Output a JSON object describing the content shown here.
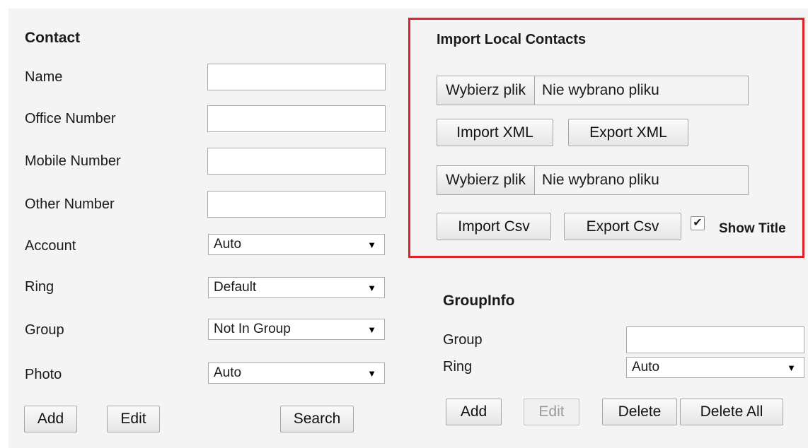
{
  "contact": {
    "title": "Contact",
    "name_label": "Name",
    "office_label": "Office Number",
    "mobile_label": "Mobile Number",
    "other_label": "Other Number",
    "account_label": "Account",
    "account_value": "Auto",
    "ring_label": "Ring",
    "ring_value": "Default",
    "group_label": "Group",
    "group_value": "Not In Group",
    "photo_label": "Photo",
    "photo_value": "Auto",
    "add_label": "Add",
    "edit_label": "Edit",
    "search_label": "Search"
  },
  "import": {
    "title": "Import Local Contacts",
    "choose_file_label": "Wybierz plik",
    "no_file_text": "Nie wybrano pliku",
    "import_xml_label": "Import XML",
    "export_xml_label": "Export XML",
    "import_csv_label": "Import Csv",
    "export_csv_label": "Export Csv",
    "show_title_label": "Show Title",
    "show_title_checked": true
  },
  "group_info": {
    "title": "GroupInfo",
    "group_label": "Group",
    "ring_label": "Ring",
    "ring_value": "Auto",
    "add_label": "Add",
    "edit_label": "Edit",
    "delete_label": "Delete",
    "delete_all_label": "Delete All"
  },
  "icons": {
    "select_arrow": "chevron-down-icon",
    "checkbox": "check-icon"
  },
  "colors": {
    "highlight_border": "#e0202a",
    "panel_bg": "#f4f4f4"
  }
}
